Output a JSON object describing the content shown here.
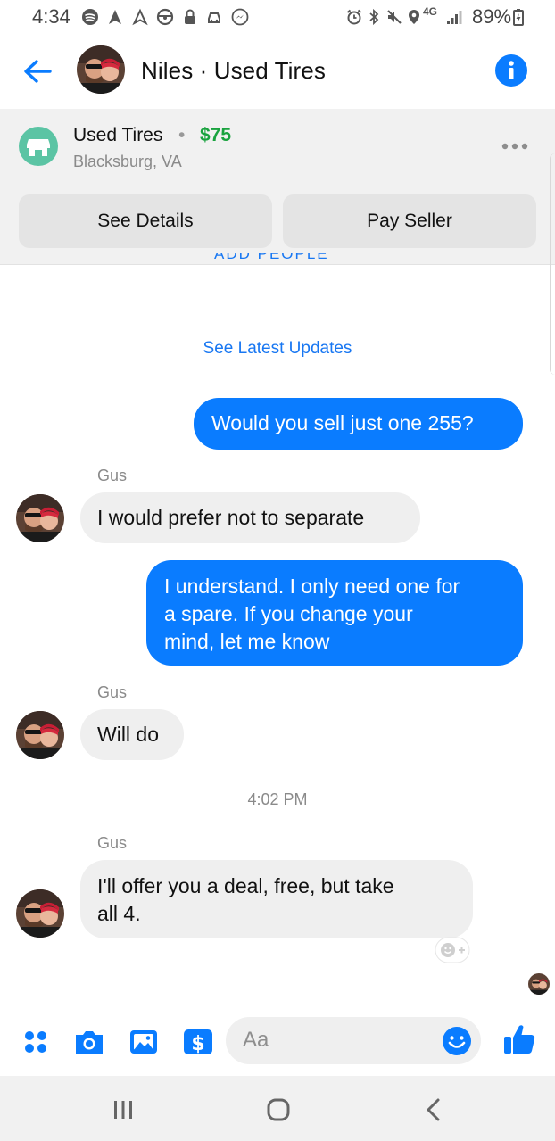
{
  "status_bar": {
    "time": "4:34",
    "battery": "89%",
    "net": "4G"
  },
  "header": {
    "title": "Niles · Used Tires",
    "back_icon": "arrow-left-icon",
    "info_icon": "info-icon"
  },
  "listing": {
    "title": "Used Tires",
    "separator": "•",
    "price": "$75",
    "location": "Blacksburg, VA",
    "details_label": "See Details",
    "pay_label": "Pay Seller",
    "peek_text": "ADD PEOPLE"
  },
  "see_latest": "See Latest Updates",
  "messages": [
    {
      "from": "me",
      "text": "Would you sell just one 255?"
    },
    {
      "from": "them",
      "sender": "Gus",
      "text": "I would prefer not to separate"
    },
    {
      "from": "me",
      "lines": [
        "I understand. I only need one for",
        "a spare. If you change your",
        "mind, let me know"
      ]
    },
    {
      "from": "them",
      "sender": "Gus",
      "text": "Will do"
    },
    {
      "timestamp": "4:02 PM"
    },
    {
      "from": "them",
      "sender": "Gus",
      "lines": [
        "I'll offer you a deal, free, but take",
        "all 4."
      ]
    }
  ],
  "composer": {
    "placeholder": "Aa",
    "tools": [
      "apps-icon",
      "camera-icon",
      "image-icon",
      "payment-icon"
    ],
    "emoji_icon": "emoji-icon",
    "like_icon": "thumbs-up-icon"
  },
  "colors": {
    "accent": "#0a7cff",
    "price": "#1aa33f",
    "shop": "#5bc4a4",
    "bubble_in": "#efefef"
  }
}
